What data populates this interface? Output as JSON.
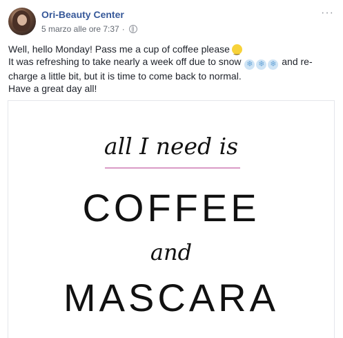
{
  "post": {
    "page_name": "Ori-Beauty Center",
    "timestamp": "5 marzo alle ore 7:37",
    "separator": "·",
    "privacy_icon": "globe-icon",
    "more_label": "···",
    "text_lines": [
      "Well, hello Monday! Pass me a cup of coffee please",
      "It was refreshing to take nearly a week off due to snow",
      "and re-",
      "charge a little bit, but it is time to come back to normal.",
      "Have a great day all!"
    ],
    "emoji": {
      "smiley": "smiley-icon",
      "snowflake": "❄"
    }
  },
  "image": {
    "line1": "all I need is",
    "line2": "COFFEE",
    "line3": "and",
    "line4": "MASCARA",
    "accent_color": "#d99ac6"
  },
  "colors": {
    "link": "#365899",
    "meta": "#616770",
    "text": "#1d2129"
  }
}
